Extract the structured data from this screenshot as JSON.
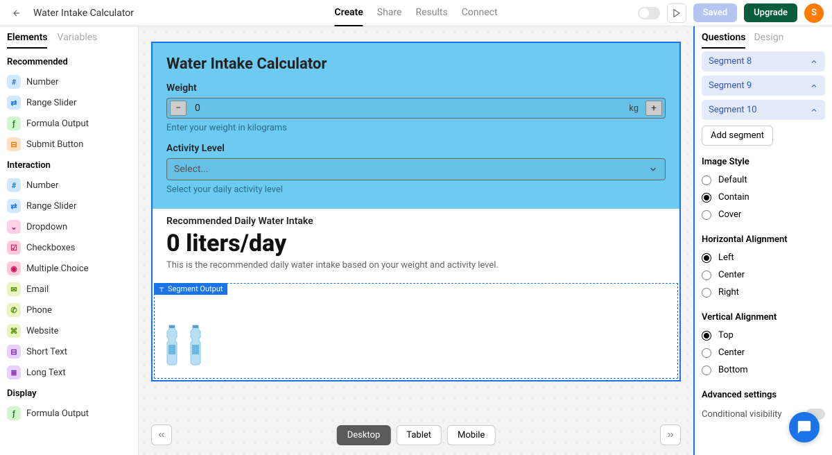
{
  "header": {
    "project_title": "Water Intake Calculator",
    "tabs": [
      "Create",
      "Share",
      "Results",
      "Connect"
    ],
    "active_tab": 0,
    "saved_label": "Saved",
    "upgrade_label": "Upgrade",
    "avatar_initial": "S"
  },
  "left_panel": {
    "tabs": [
      "Elements",
      "Variables"
    ],
    "active_tab": 0,
    "sections": [
      {
        "heading": "Recommended",
        "items": [
          {
            "icon_class": "ic-blue",
            "glyph": "#",
            "label": "Number",
            "icon_name": "number-icon"
          },
          {
            "icon_class": "ic-blue",
            "glyph": "⇄",
            "label": "Range Slider",
            "icon_name": "slider-icon"
          },
          {
            "icon_class": "ic-green",
            "glyph": "ƒ",
            "label": "Formula Output",
            "icon_name": "formula-icon"
          },
          {
            "icon_class": "ic-orange",
            "glyph": "⊟",
            "label": "Submit Button",
            "icon_name": "submit-icon"
          }
        ]
      },
      {
        "heading": "Interaction",
        "items": [
          {
            "icon_class": "ic-blue",
            "glyph": "#",
            "label": "Number",
            "icon_name": "number-icon"
          },
          {
            "icon_class": "ic-blue",
            "glyph": "⇄",
            "label": "Range Slider",
            "icon_name": "slider-icon"
          },
          {
            "icon_class": "ic-pink",
            "glyph": "⌄",
            "label": "Dropdown",
            "icon_name": "dropdown-icon"
          },
          {
            "icon_class": "ic-magenta",
            "glyph": "☑",
            "label": "Checkboxes",
            "icon_name": "checkbox-icon"
          },
          {
            "icon_class": "ic-magenta",
            "glyph": "◉",
            "label": "Multiple Choice",
            "icon_name": "radio-icon"
          },
          {
            "icon_class": "ic-lime",
            "glyph": "✉",
            "label": "Email",
            "icon_name": "email-icon"
          },
          {
            "icon_class": "ic-lime",
            "glyph": "✆",
            "label": "Phone",
            "icon_name": "phone-icon"
          },
          {
            "icon_class": "ic-lime",
            "glyph": "⌘",
            "label": "Website",
            "icon_name": "website-icon"
          },
          {
            "icon_class": "ic-purple",
            "glyph": "⊟",
            "label": "Short Text",
            "icon_name": "shorttext-icon"
          },
          {
            "icon_class": "ic-purple",
            "glyph": "≣",
            "label": "Long Text",
            "icon_name": "longtext-icon"
          }
        ]
      },
      {
        "heading": "Display",
        "items": [
          {
            "icon_class": "ic-green",
            "glyph": "ƒ",
            "label": "Formula Output",
            "icon_name": "formula-icon"
          }
        ]
      }
    ]
  },
  "canvas": {
    "title": "Water Intake Calculator",
    "weight": {
      "label": "Weight",
      "value": "0",
      "unit": "kg",
      "help": "Enter your weight in kilograms"
    },
    "activity": {
      "label": "Activity Level",
      "placeholder": "Select...",
      "help": "Select your daily activity level"
    },
    "result": {
      "label": "Recommended Daily Water Intake",
      "value": "0 liters/day",
      "help": "This is the recommended daily water intake based on your weight and activity level."
    },
    "segment_tag": "Segment Output",
    "devices": [
      "Desktop",
      "Tablet",
      "Mobile"
    ],
    "active_device": 0
  },
  "right_panel": {
    "tabs": [
      "Questions",
      "Design"
    ],
    "active_tab": 0,
    "segments": [
      "Segment 8",
      "Segment 9",
      "Segment 10"
    ],
    "add_segment_label": "Add segment",
    "image_style": {
      "heading": "Image Style",
      "options": [
        "Default",
        "Contain",
        "Cover"
      ],
      "selected": 1
    },
    "h_align": {
      "heading": "Horizontal Alignment",
      "options": [
        "Left",
        "Center",
        "Right"
      ],
      "selected": 0
    },
    "v_align": {
      "heading": "Vertical Alignment",
      "options": [
        "Top",
        "Center",
        "Bottom"
      ],
      "selected": 0
    },
    "advanced_heading": "Advanced settings",
    "conditional_label": "Conditional visibility"
  }
}
